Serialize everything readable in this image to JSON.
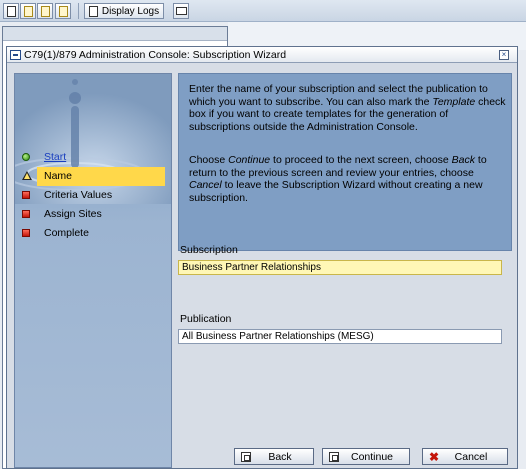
{
  "toolbar": {
    "display_logs_label": "Display Logs"
  },
  "dialog": {
    "title": "C79(1)/879 Administration Console: Subscription Wizard"
  },
  "steps": [
    {
      "label": "Start",
      "status": "done"
    },
    {
      "label": "Name",
      "status": "current"
    },
    {
      "label": "Criteria Values",
      "status": "pending"
    },
    {
      "label": "Assign Sites",
      "status": "pending"
    },
    {
      "label": "Complete",
      "status": "pending"
    }
  ],
  "instructions": {
    "p1_a": "Enter the name of your subscription and select the publication to which you want to subscribe. You can also mark the ",
    "p1_em": "Template",
    "p1_b": " check box if you want to create templates for the generation of subscriptions outside the Administration Console.",
    "p2_a": "Choose ",
    "p2_em1": "Continue",
    "p2_b": " to proceed to the next screen, choose ",
    "p2_em2": "Back",
    "p2_c": " to return to the previous screen and review your entries, choose ",
    "p2_em3": "Cancel",
    "p2_d": " to leave the Subscription Wizard without creating a new subscription."
  },
  "form": {
    "subscription_label": "Subscription",
    "subscription_value": "Business Partner Relationships",
    "publication_label": "Publication",
    "publication_value": "All Business Partner Relationships (MESG)"
  },
  "buttons": {
    "back": "Back",
    "continue": "Continue",
    "cancel": "Cancel"
  },
  "colors": {
    "active_step": "#ffd84a",
    "instruction_panel": "#7f9ec4",
    "subscription_field": "#fff7b6"
  }
}
